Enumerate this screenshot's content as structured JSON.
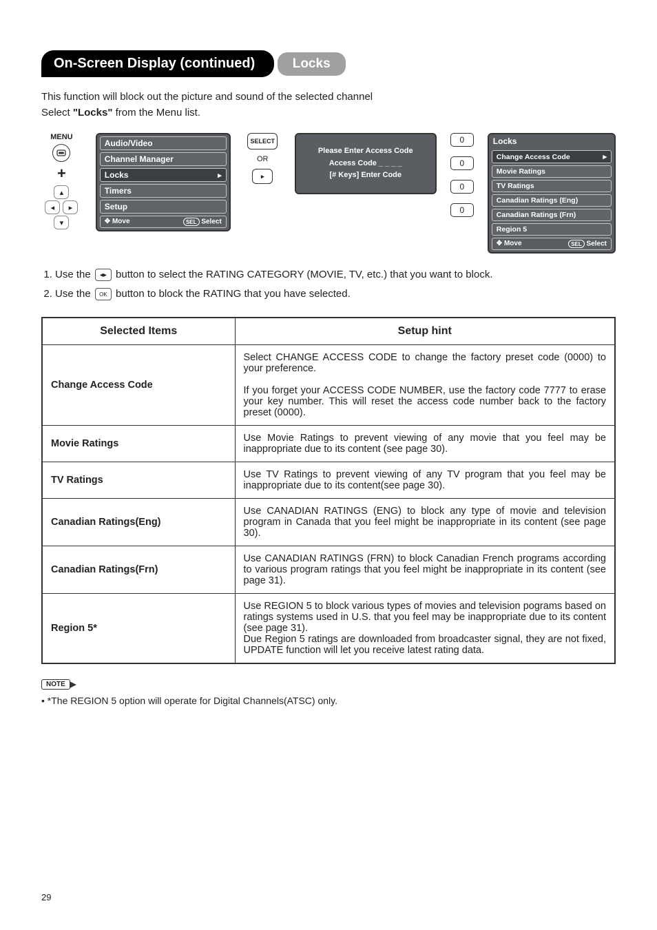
{
  "header": {
    "title": "On-Screen Display (continued)"
  },
  "section": {
    "title": "Locks"
  },
  "intro": {
    "line1": "This function will block out the picture and sound of the selected channel",
    "line2_a": "Select ",
    "line2_b": "\"Locks\"",
    "line2_c": " from the Menu list."
  },
  "remote": {
    "menu_label": "MENU",
    "select_label": "SELECT",
    "or_label": "OR"
  },
  "osd_main": {
    "items": [
      "Audio/Video",
      "Channel Manager",
      "Locks",
      "Timers",
      "Setup"
    ],
    "highlight_index": 2,
    "footer_move": "Move",
    "footer_sel_pill": "SEL",
    "footer_select": "Select"
  },
  "modal": {
    "l1": "Please Enter Access Code",
    "l2": "Access Code   _ _ _ _",
    "l3": "[# Keys] Enter Code"
  },
  "keypad": [
    "0",
    "0",
    "0",
    "0"
  ],
  "locks_menu": {
    "title": "Locks",
    "items": [
      "Change Access Code",
      "Movie Ratings",
      "TV Ratings",
      "Canadian Ratings (Eng)",
      "Canadian Ratings (Frn)",
      "Region 5"
    ],
    "highlight_index": 0,
    "footer_move": "Move",
    "footer_sel_pill": "SEL",
    "footer_select": "Select"
  },
  "steps": {
    "s1_a": "Use the ",
    "s1_b": " button to select the RATING CATEGORY (MOVIE, TV, etc.) that you want to block.",
    "s2_a": "Use the ",
    "s2_b": " button to block the RATING that you have selected.",
    "icon1": "◂▸",
    "icon2": "OK"
  },
  "table": {
    "h1": "Selected Items",
    "h2": "Setup hint",
    "rows": [
      {
        "name": "Change Access Code",
        "hint": "Select CHANGE ACCESS CODE to change the factory preset code (0000) to your preference.\n\nIf you forget your ACCESS CODE NUMBER, use the factory code 7777 to erase your key number. This will reset the access code number back to the factory preset (0000)."
      },
      {
        "name": "Movie Ratings",
        "hint": "Use Movie Ratings to prevent viewing of any movie that you feel may be inappropriate due to its content (see page 30)."
      },
      {
        "name": "TV Ratings",
        "hint": "Use TV Ratings to prevent viewing of any TV program that you feel may be inappropriate due to its content(see page 30)."
      },
      {
        "name": "Canadian Ratings(Eng)",
        "hint": "Use CANADIAN RATINGS (ENG) to block any type of movie and television program in Canada that you feel might be inappropriate in its content (see page 30)."
      },
      {
        "name": "Canadian Ratings(Frn)",
        "hint": "Use CANADIAN RATINGS (FRN) to block Canadian French programs according to various program ratings that you feel might be inappropriate in its content (see page 31)."
      },
      {
        "name": "Region 5*",
        "hint": "Use REGION 5 to block various types of movies and television pograms based on ratings systems used in U.S. that you feel may be inappropriate due to its content (see page 31).\nDue Region 5 ratings are downloaded from broadcaster signal, they are not  fixed, UPDATE function will let you receive latest rating data."
      }
    ]
  },
  "note": {
    "label": "NOTE",
    "text": "• *The REGION 5 option will operate for Digital Channels(ATSC) only."
  },
  "page_number": "29"
}
